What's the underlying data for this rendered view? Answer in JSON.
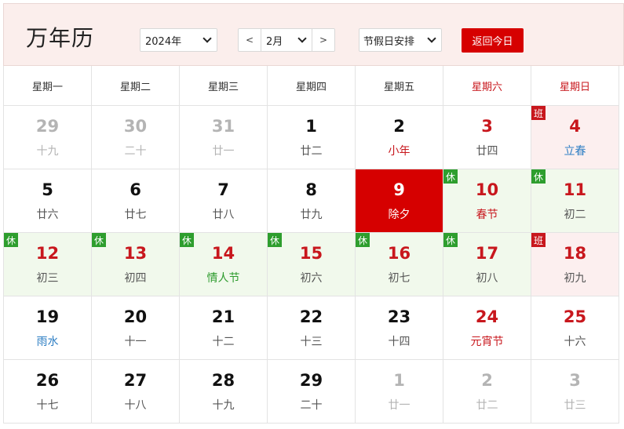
{
  "header": {
    "title": "万年历",
    "year_value": "2024年",
    "month_prev": "<",
    "month_value": "2月",
    "month_next": ">",
    "holiday_value": "节假日安排",
    "today_button": "返回今日"
  },
  "weekdays": [
    {
      "label": "星期一",
      "weekend": false
    },
    {
      "label": "星期二",
      "weekend": false
    },
    {
      "label": "星期三",
      "weekend": false
    },
    {
      "label": "星期四",
      "weekend": false
    },
    {
      "label": "星期五",
      "weekend": false
    },
    {
      "label": "星期六",
      "weekend": true
    },
    {
      "label": "星期日",
      "weekend": true
    }
  ],
  "days": [
    {
      "day": "29",
      "sub": "十九",
      "other": true
    },
    {
      "day": "30",
      "sub": "二十",
      "other": true
    },
    {
      "day": "31",
      "sub": "廿一",
      "other": true
    },
    {
      "day": "1",
      "sub": "廿二"
    },
    {
      "day": "2",
      "sub": "小年",
      "sub_color": "red"
    },
    {
      "day": "3",
      "sub": "廿四",
      "day_color": "red"
    },
    {
      "day": "4",
      "sub": "立春",
      "day_color": "red",
      "sub_color": "blue",
      "badge": "班",
      "badge_type": "work"
    },
    {
      "day": "5",
      "sub": "廿六"
    },
    {
      "day": "6",
      "sub": "廿七"
    },
    {
      "day": "7",
      "sub": "廿八"
    },
    {
      "day": "8",
      "sub": "廿九"
    },
    {
      "day": "9",
      "sub": "除夕",
      "selected": true
    },
    {
      "day": "10",
      "sub": "春节",
      "day_color": "red",
      "sub_color": "red",
      "badge": "休",
      "badge_type": "rest"
    },
    {
      "day": "11",
      "sub": "初二",
      "day_color": "red",
      "badge": "休",
      "badge_type": "rest"
    },
    {
      "day": "12",
      "sub": "初三",
      "day_color": "red",
      "badge": "休",
      "badge_type": "rest"
    },
    {
      "day": "13",
      "sub": "初四",
      "day_color": "red",
      "badge": "休",
      "badge_type": "rest"
    },
    {
      "day": "14",
      "sub": "情人节",
      "day_color": "red",
      "sub_color": "green",
      "badge": "休",
      "badge_type": "rest"
    },
    {
      "day": "15",
      "sub": "初六",
      "day_color": "red",
      "badge": "休",
      "badge_type": "rest"
    },
    {
      "day": "16",
      "sub": "初七",
      "day_color": "red",
      "badge": "休",
      "badge_type": "rest"
    },
    {
      "day": "17",
      "sub": "初八",
      "day_color": "red",
      "badge": "休",
      "badge_type": "rest"
    },
    {
      "day": "18",
      "sub": "初九",
      "day_color": "red",
      "badge": "班",
      "badge_type": "work"
    },
    {
      "day": "19",
      "sub": "雨水",
      "sub_color": "blue"
    },
    {
      "day": "20",
      "sub": "十一"
    },
    {
      "day": "21",
      "sub": "十二"
    },
    {
      "day": "22",
      "sub": "十三"
    },
    {
      "day": "23",
      "sub": "十四"
    },
    {
      "day": "24",
      "sub": "元宵节",
      "day_color": "red",
      "sub_color": "red"
    },
    {
      "day": "25",
      "sub": "十六",
      "day_color": "red"
    },
    {
      "day": "26",
      "sub": "十七"
    },
    {
      "day": "27",
      "sub": "十八"
    },
    {
      "day": "28",
      "sub": "十九"
    },
    {
      "day": "29",
      "sub": "二十"
    },
    {
      "day": "1",
      "sub": "廿一",
      "other": true
    },
    {
      "day": "2",
      "sub": "廿二",
      "other": true
    },
    {
      "day": "3",
      "sub": "廿三",
      "other": true
    }
  ],
  "colors": {
    "accent_red": "#d60000",
    "holiday_red": "#c8171d",
    "rest_green": "#2e9e2e",
    "rest_bg": "#f1f9ec",
    "work_bg": "#fcefef",
    "solar_term_blue": "#2f7fc4",
    "header_bg": "#fbeeec"
  }
}
